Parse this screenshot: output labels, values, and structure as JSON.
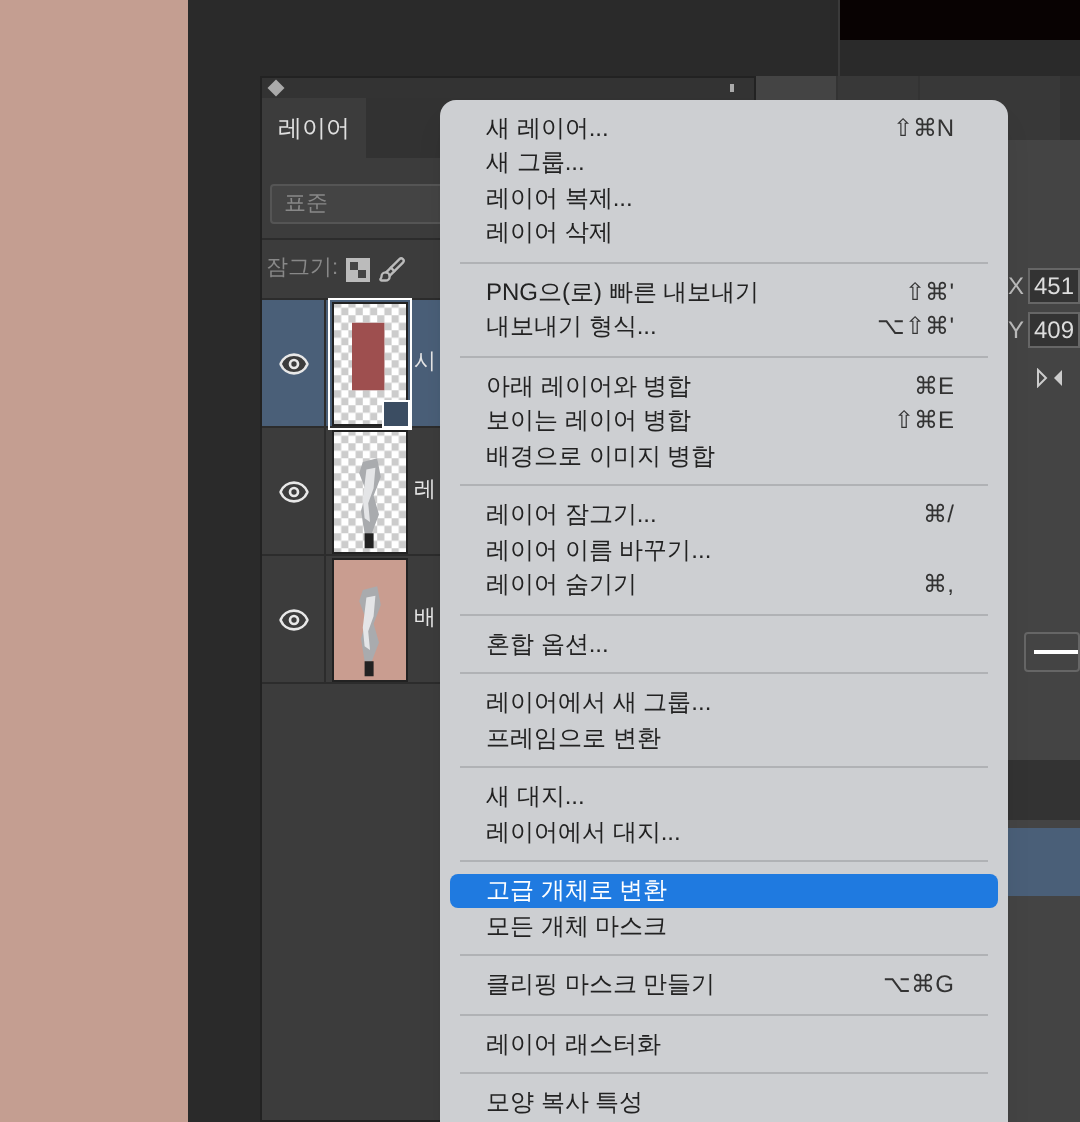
{
  "layers_panel": {
    "tab": "레이어",
    "filter": {
      "value": "표준"
    },
    "lock_label": "잠그기:",
    "layers": [
      {
        "name": "시",
        "selected": true,
        "kind": "red-rect",
        "visible": true
      },
      {
        "name": "레",
        "selected": false,
        "kind": "foil",
        "visible": true
      },
      {
        "name": "배",
        "selected": false,
        "kind": "foil-background",
        "visible": true
      }
    ]
  },
  "panel_tabs": [
    {
      "selected": true
    },
    {
      "selected": false
    },
    {
      "selected": false
    }
  ],
  "properties": {
    "x_label": "X",
    "x_value": "451",
    "y_label": "Y",
    "y_value": "409"
  },
  "context_menu": [
    {
      "kind": "item",
      "label": "새 레이어...",
      "shortcut": "⇧⌘N",
      "selected": false
    },
    {
      "kind": "item",
      "label": "새 그룹...",
      "selected": false
    },
    {
      "kind": "item",
      "label": "레이어 복제...",
      "selected": false
    },
    {
      "kind": "item",
      "label": "레이어 삭제",
      "selected": false
    },
    {
      "kind": "separator"
    },
    {
      "kind": "item",
      "label": "PNG으(로) 빠른 내보내기",
      "shortcut": "⇧⌘'",
      "selected": false
    },
    {
      "kind": "item",
      "label": "내보내기 형식...",
      "shortcut": "⌥⇧⌘'",
      "selected": false
    },
    {
      "kind": "separator"
    },
    {
      "kind": "item",
      "label": "아래 레이어와 병합",
      "shortcut": "⌘E",
      "selected": false
    },
    {
      "kind": "item",
      "label": "보이는 레이어 병합",
      "shortcut": "⇧⌘E",
      "selected": false
    },
    {
      "kind": "item",
      "label": "배경으로 이미지 병합",
      "selected": false
    },
    {
      "kind": "separator"
    },
    {
      "kind": "item",
      "label": "레이어 잠그기...",
      "shortcut": "⌘/",
      "selected": false
    },
    {
      "kind": "item",
      "label": "레이어 이름 바꾸기...",
      "selected": false
    },
    {
      "kind": "item",
      "label": "레이어 숨기기",
      "shortcut": "⌘,",
      "selected": false
    },
    {
      "kind": "separator"
    },
    {
      "kind": "item",
      "label": "혼합 옵션...",
      "selected": false
    },
    {
      "kind": "separator"
    },
    {
      "kind": "item",
      "label": "레이어에서 새 그룹...",
      "selected": false
    },
    {
      "kind": "item",
      "label": "프레임으로 변환",
      "selected": false
    },
    {
      "kind": "separator"
    },
    {
      "kind": "item",
      "label": "새 대지...",
      "selected": false
    },
    {
      "kind": "item",
      "label": "레이어에서 대지...",
      "selected": false
    },
    {
      "kind": "separator"
    },
    {
      "kind": "item",
      "label": "고급 개체로 변환",
      "selected": true
    },
    {
      "kind": "item",
      "label": "모든 개체 마스크",
      "selected": false
    },
    {
      "kind": "separator"
    },
    {
      "kind": "item",
      "label": "클리핑 마스크 만들기",
      "shortcut": "⌥⌘G",
      "selected": false
    },
    {
      "kind": "separator"
    },
    {
      "kind": "item",
      "label": "레이어 래스터화",
      "selected": false
    },
    {
      "kind": "separator"
    },
    {
      "kind": "item",
      "label": "모양 복사 특성",
      "selected": false
    }
  ]
}
